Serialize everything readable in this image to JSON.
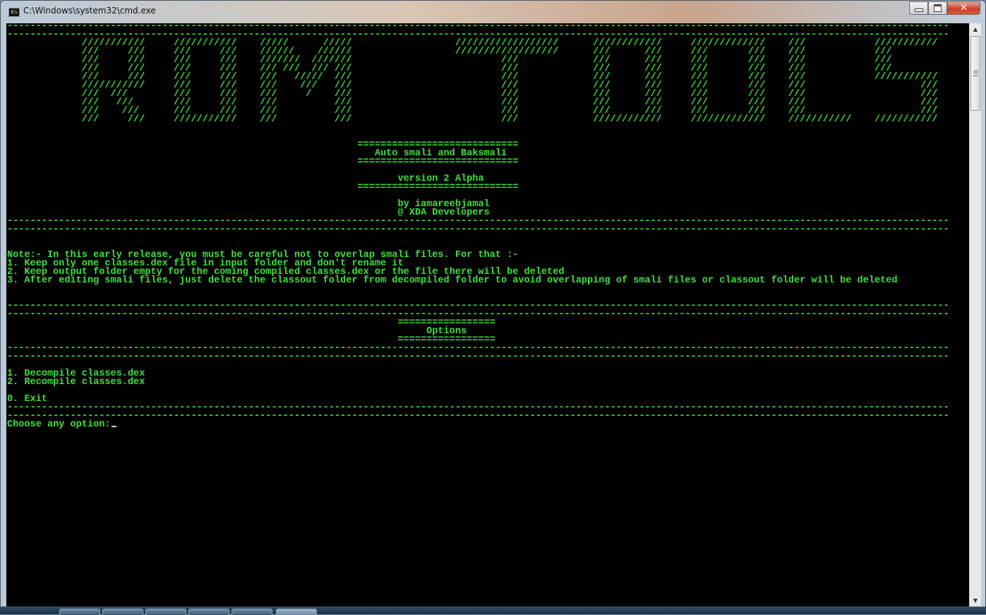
{
  "window": {
    "title": "C:\\Windows\\system32\\cmd.exe",
    "app_icon_text": "C:\\",
    "close_glyph": "✕"
  },
  "console": {
    "banner_logo_text": "ROM TOOLS",
    "dash_line": "--------------------------------------------------------------------------------------------------------------------------------------------------------------------",
    "header": {
      "rule": "============================",
      "app_name": "Auto smali and Baksmali",
      "version": "version 2 Alpha",
      "author": "by iamareebjamal",
      "community": "@ XDA Developers"
    },
    "note": {
      "heading": "Note:- In this early release, you must be careful not to overlap smali files. For that :-",
      "items": [
        "1. Keep only one classes.dex file in input folder and don't rename it",
        "2. Keep output folder empty for the coming compiled classes.dex or the file there will be deleted",
        "3. After editing smali files, just delete the classout folder from decompiled folder to avoid overlapping of smali files or classout folder will be deleted"
      ]
    },
    "options": {
      "rule": "=================",
      "title": "Options",
      "items": [
        "1. Decompile classes.dex",
        "2. Recompile classes.dex"
      ],
      "exit": "0. Exit"
    },
    "prompt": "Choose any option:"
  },
  "colors": {
    "console_bg": "#000000",
    "console_fg": "#3fe03f"
  }
}
